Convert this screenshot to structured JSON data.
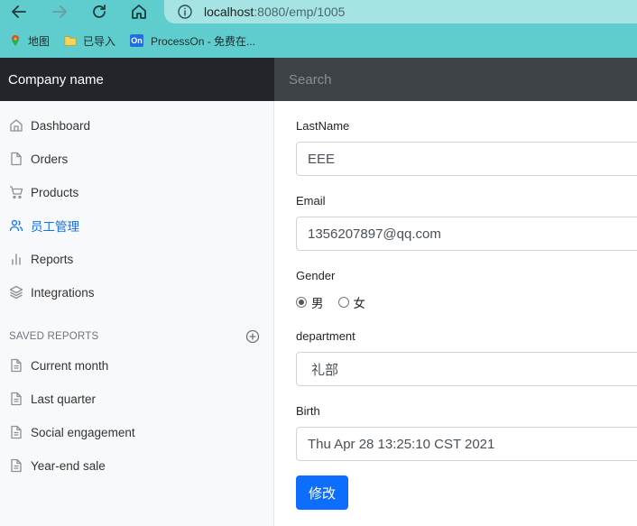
{
  "browser": {
    "url_host": "localhost",
    "url_rest": ":8080/emp/1005",
    "bookmarks": [
      {
        "label": "地图",
        "icon": "map-pin-icon"
      },
      {
        "label": "已导入",
        "icon": "folder-icon"
      },
      {
        "label": "ProcessOn - 免费在...",
        "icon": "processon-icon",
        "badge": "On"
      }
    ]
  },
  "navbar": {
    "brand": "Company name",
    "search_placeholder": "Search"
  },
  "sidebar": {
    "items": [
      {
        "label": "Dashboard",
        "icon": "home-icon"
      },
      {
        "label": "Orders",
        "icon": "file-icon"
      },
      {
        "label": "Products",
        "icon": "cart-icon"
      },
      {
        "label": "员工管理",
        "icon": "users-icon",
        "active": true
      },
      {
        "label": "Reports",
        "icon": "bar-chart-icon"
      },
      {
        "label": "Integrations",
        "icon": "layers-icon"
      }
    ],
    "saved_reports_heading": "SAVED REPORTS",
    "reports": [
      {
        "label": "Current month",
        "icon": "file-text-icon"
      },
      {
        "label": "Last quarter",
        "icon": "file-text-icon"
      },
      {
        "label": "Social engagement",
        "icon": "file-text-icon"
      },
      {
        "label": "Year-end sale",
        "icon": "file-text-icon"
      }
    ]
  },
  "form": {
    "lastname_label": "LastName",
    "lastname_value": "EEE",
    "email_label": "Email",
    "email_value": "1356207897@qq.com",
    "gender_label": "Gender",
    "gender_male": "男",
    "gender_female": "女",
    "gender_selected": "男",
    "department_label": "department",
    "department_value": "礼部",
    "birth_label": "Birth",
    "birth_value": "Thu Apr 28 13:25:10 CST 2021",
    "submit_label": "修改"
  },
  "colors": {
    "chrome": "#5fcdcd",
    "accent": "#0d6efd",
    "navbar": "#343a40"
  }
}
